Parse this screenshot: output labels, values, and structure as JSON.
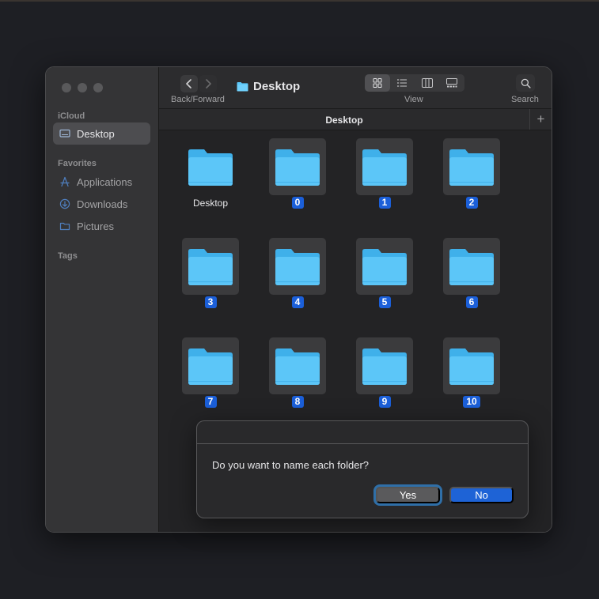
{
  "sidebar": {
    "sections": [
      {
        "label": "iCloud"
      },
      {
        "label": "Favorites"
      },
      {
        "label": "Tags"
      }
    ],
    "items": [
      {
        "label": "Desktop",
        "icon": "desktop-icon",
        "active": true
      },
      {
        "label": "Applications",
        "icon": "applications-icon"
      },
      {
        "label": "Downloads",
        "icon": "downloads-icon"
      },
      {
        "label": "Pictures",
        "icon": "pictures-icon"
      }
    ]
  },
  "toolbar": {
    "back_forward_label": "Back/Forward",
    "title": "Desktop",
    "view_label": "View",
    "search_label": "Search",
    "active_view": "icon"
  },
  "pathbar": {
    "title": "Desktop",
    "add_label": "+"
  },
  "folders": [
    {
      "name": "Desktop"
    },
    {
      "name": "0"
    },
    {
      "name": "1"
    },
    {
      "name": "2"
    },
    {
      "name": "3"
    },
    {
      "name": "4"
    },
    {
      "name": "5"
    },
    {
      "name": "6"
    },
    {
      "name": "7"
    },
    {
      "name": "8"
    },
    {
      "name": "9"
    },
    {
      "name": "10"
    }
  ],
  "dialog": {
    "message": "Do you want to name each folder?",
    "yes_label": "Yes",
    "no_label": "No"
  },
  "colors": {
    "accent": "#1e63d6",
    "folder": "#5ac8fa",
    "selection_badge": "#1b5fd9"
  }
}
